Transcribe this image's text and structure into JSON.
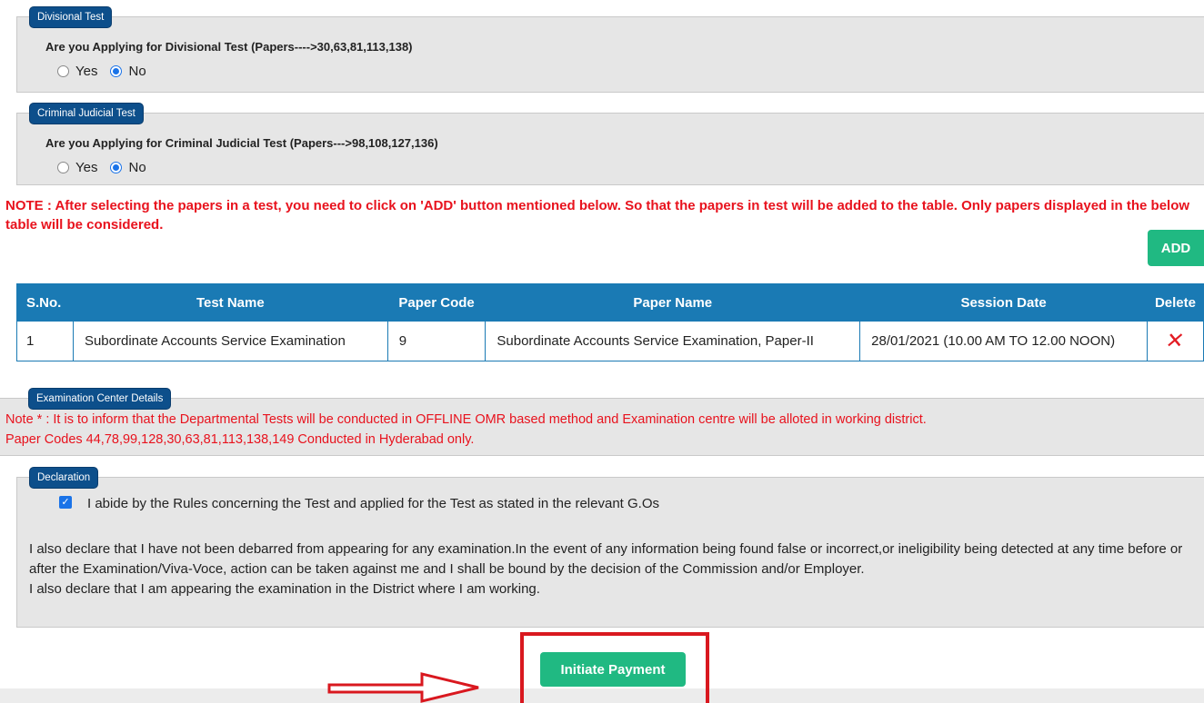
{
  "divisional": {
    "legend": "Divisional Test",
    "question": "Are you Applying for Divisional Test (Papers---->30,63,81,113,138)",
    "options": [
      {
        "label": "Yes",
        "checked": false
      },
      {
        "label": "No",
        "checked": true
      }
    ]
  },
  "criminal": {
    "legend": "Criminal Judicial Test",
    "question": "Are you Applying for Criminal Judicial Test (Papers--->98,108,127,136)",
    "options": [
      {
        "label": "Yes",
        "checked": false
      },
      {
        "label": "No",
        "checked": true
      }
    ]
  },
  "note": "NOTE : After selecting the papers in a test, you need to click on 'ADD' button mentioned below. So that the papers in test will be added to the table. Only papers displayed in the below table will be considered.",
  "add_button": "ADD",
  "table": {
    "headers": [
      "S.No.",
      "Test Name",
      "Paper Code",
      "Paper Name",
      "Session Date",
      "Delete"
    ],
    "rows": [
      {
        "sno": "1",
        "test_name": "Subordinate Accounts Service Examination",
        "paper_code": "9",
        "paper_name": "Subordinate Accounts Service Examination, Paper-II",
        "session_date": "28/01/2021 (10.00 AM TO 12.00 NOON)"
      }
    ]
  },
  "exam_center": {
    "legend": "Examination Center Details",
    "note_line1": "Note * : It is to inform that the Departmental Tests will be conducted in OFFLINE OMR based method and Examination centre will be alloted in working district.",
    "note_line2": "Paper Codes 44,78,99,128,30,63,81,113,138,149 Conducted in Hyderabad only."
  },
  "declaration": {
    "legend": "Declaration",
    "checked": true,
    "check_label": "I abide by the Rules concerning the Test and applied for the Test as stated in the relevant G.Os",
    "para1": "I also declare that I have not been debarred from appearing for any examination.In the event of any information being found false or incorrect,or ineligibility being detected at any time before or after the Examination/Viva-Voce, action can be taken against me and I shall be bound by the decision of the Commission and/or Employer.",
    "para2": "I also declare that I am appearing the examination in the District where I am working."
  },
  "pay_button": "Initiate Payment",
  "colors": {
    "legend_bg": "#0d4f8b",
    "table_header": "#1a7ab4",
    "button_green": "#20b982",
    "note_red": "#e8121d",
    "annotation_red": "#d9181f"
  }
}
